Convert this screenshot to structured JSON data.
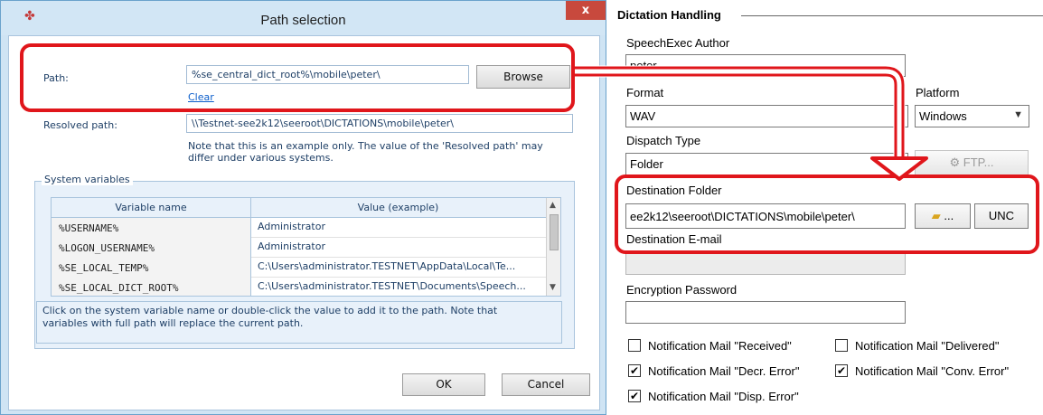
{
  "dialog": {
    "title": "Path selection",
    "close_label": "x",
    "path_label": "Path:",
    "path_value": "%se_central_dict_root%\\mobile\\peter\\",
    "browse_label": "Browse",
    "clear_label": "Clear",
    "resolved_label": "Resolved path:",
    "resolved_value": "\\\\Testnet-see2k12\\seeroot\\DICTATIONS\\mobile\\peter\\",
    "note_line1": "Note that this is an example only. The value of the 'Resolved path' may",
    "note_line2": "differ under various systems.",
    "group_title": "System variables",
    "columns": [
      "Variable name",
      "Value (example)"
    ],
    "rows": [
      {
        "name": "%USERNAME%",
        "value": "Administrator"
      },
      {
        "name": "%LOGON_USERNAME%",
        "value": "Administrator"
      },
      {
        "name": "%SE_LOCAL_TEMP%",
        "value": "C:\\Users\\administrator.TESTNET\\AppData\\Local\\Te..."
      },
      {
        "name": "%SE_LOCAL_DICT_ROOT%",
        "value": "C:\\Users\\administrator.TESTNET\\Documents\\Speech..."
      }
    ],
    "hint_line1": "Click on the system variable name or double-click the value to add it to the path. Note that",
    "hint_line2": "variables with full path will replace the current path.",
    "ok_label": "OK",
    "cancel_label": "Cancel"
  },
  "panel": {
    "title": "Dictation Handling",
    "author_label": "SpeechExec Author",
    "author_value": "peter",
    "format_label": "Format",
    "format_value": "WAV",
    "platform_label": "Platform",
    "platform_value": "Windows",
    "dispatch_label": "Dispatch Type",
    "dispatch_value": "Folder",
    "ftp_label": "FTP...",
    "dest_folder_label": "Destination Folder",
    "dest_folder_value": "ee2k12\\seeroot\\DICTATIONS\\mobile\\peter\\",
    "folder_btn_label": "...",
    "unc_label": "UNC",
    "dest_email_label": "Destination E-mail",
    "dest_email_value": "",
    "encryption_label": "Encryption Password",
    "encryption_value": "",
    "notifications": [
      {
        "label": "Notification Mail \"Received\"",
        "checked": false
      },
      {
        "label": "Notification Mail \"Delivered\"",
        "checked": false
      },
      {
        "label": "Notification Mail \"Decr. Error\"",
        "checked": true
      },
      {
        "label": "Notification Mail \"Conv. Error\"",
        "checked": true
      },
      {
        "label": "Notification Mail \"Disp. Error\"",
        "checked": true
      }
    ]
  },
  "colors": {
    "highlight": "#e0161b",
    "dialog_frame": "#cfe4f4",
    "close_button": "#c8493d",
    "link": "#0b5ecb"
  }
}
